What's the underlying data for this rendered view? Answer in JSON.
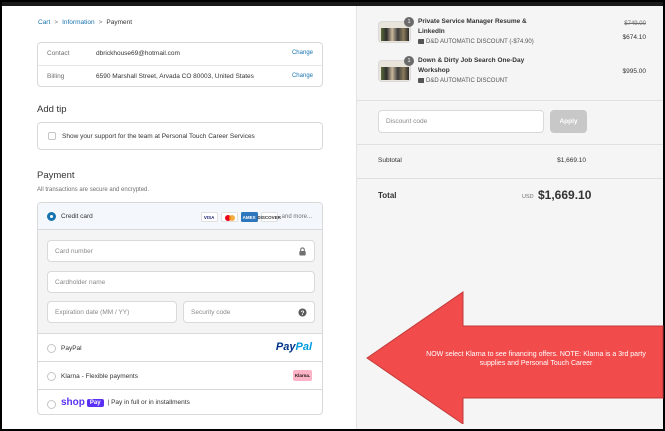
{
  "breadcrumb": {
    "items": [
      "Cart",
      "Information",
      "Payment"
    ],
    "separator": ">"
  },
  "contact": {
    "label": "Contact",
    "value": "dbrickhouse69@hotmail.com",
    "change": "Change"
  },
  "billing": {
    "label": "Billing",
    "value": "6590 Marshall Street, Arvada CO 80003, United States",
    "change": "Change"
  },
  "tip": {
    "title": "Add tip",
    "checkbox_label": "Show your support for the team at Personal Touch Career Services",
    "checked": false
  },
  "payment": {
    "title": "Payment",
    "subtitle": "All transactions are secure and encrypted.",
    "credit_card": {
      "label": "Credit card",
      "selected": true,
      "logos": [
        "VISA",
        "mastercard",
        "AMEX",
        "DISCOVER"
      ],
      "more": "and more..."
    },
    "fields": {
      "card_number": "Card number",
      "cardholder": "Cardholder name",
      "expiration": "Expiration date (MM / YY)",
      "security": "Security code"
    },
    "paypal": {
      "label": "PayPal",
      "logo_a": "Pay",
      "logo_b": "Pal"
    },
    "klarna": {
      "label": "Klarna - Flexible payments",
      "badge": "Klarna."
    },
    "shoppay": {
      "word": "shop",
      "pay": "Pay",
      "text": "| Pay in full or in installments"
    }
  },
  "order": {
    "items": [
      {
        "qty": "1",
        "title": "Private Service Manager Resume & LinkedIn",
        "discount": "D&D AUTOMATIC DISCOUNT (-$74.90)",
        "price_old": "$749.00",
        "price": "$674.10"
      },
      {
        "qty": "1",
        "title": "Down & Dirty Job Search One-Day Workshop",
        "discount": "D&D AUTOMATIC DISCOUNT",
        "price_old": "",
        "price": "$995.00"
      }
    ],
    "discount_placeholder": "Discount code",
    "apply_label": "Apply",
    "subtotal_label": "Subtotal",
    "subtotal_value": "$1,669.10",
    "total_label": "Total",
    "total_currency": "USD",
    "total_value": "$1,669.10"
  },
  "annotation": {
    "text": "NOW select Klarna to see financing offers. NOTE: Klarna is a 3rd party supplies and Personal Touch Career",
    "color": "#f24b4b"
  },
  "colors": {
    "link": "#1773b0",
    "callout": "#f24b4b",
    "klarna_pink": "#ffb3c7",
    "shop_purple": "#5a31f4"
  }
}
